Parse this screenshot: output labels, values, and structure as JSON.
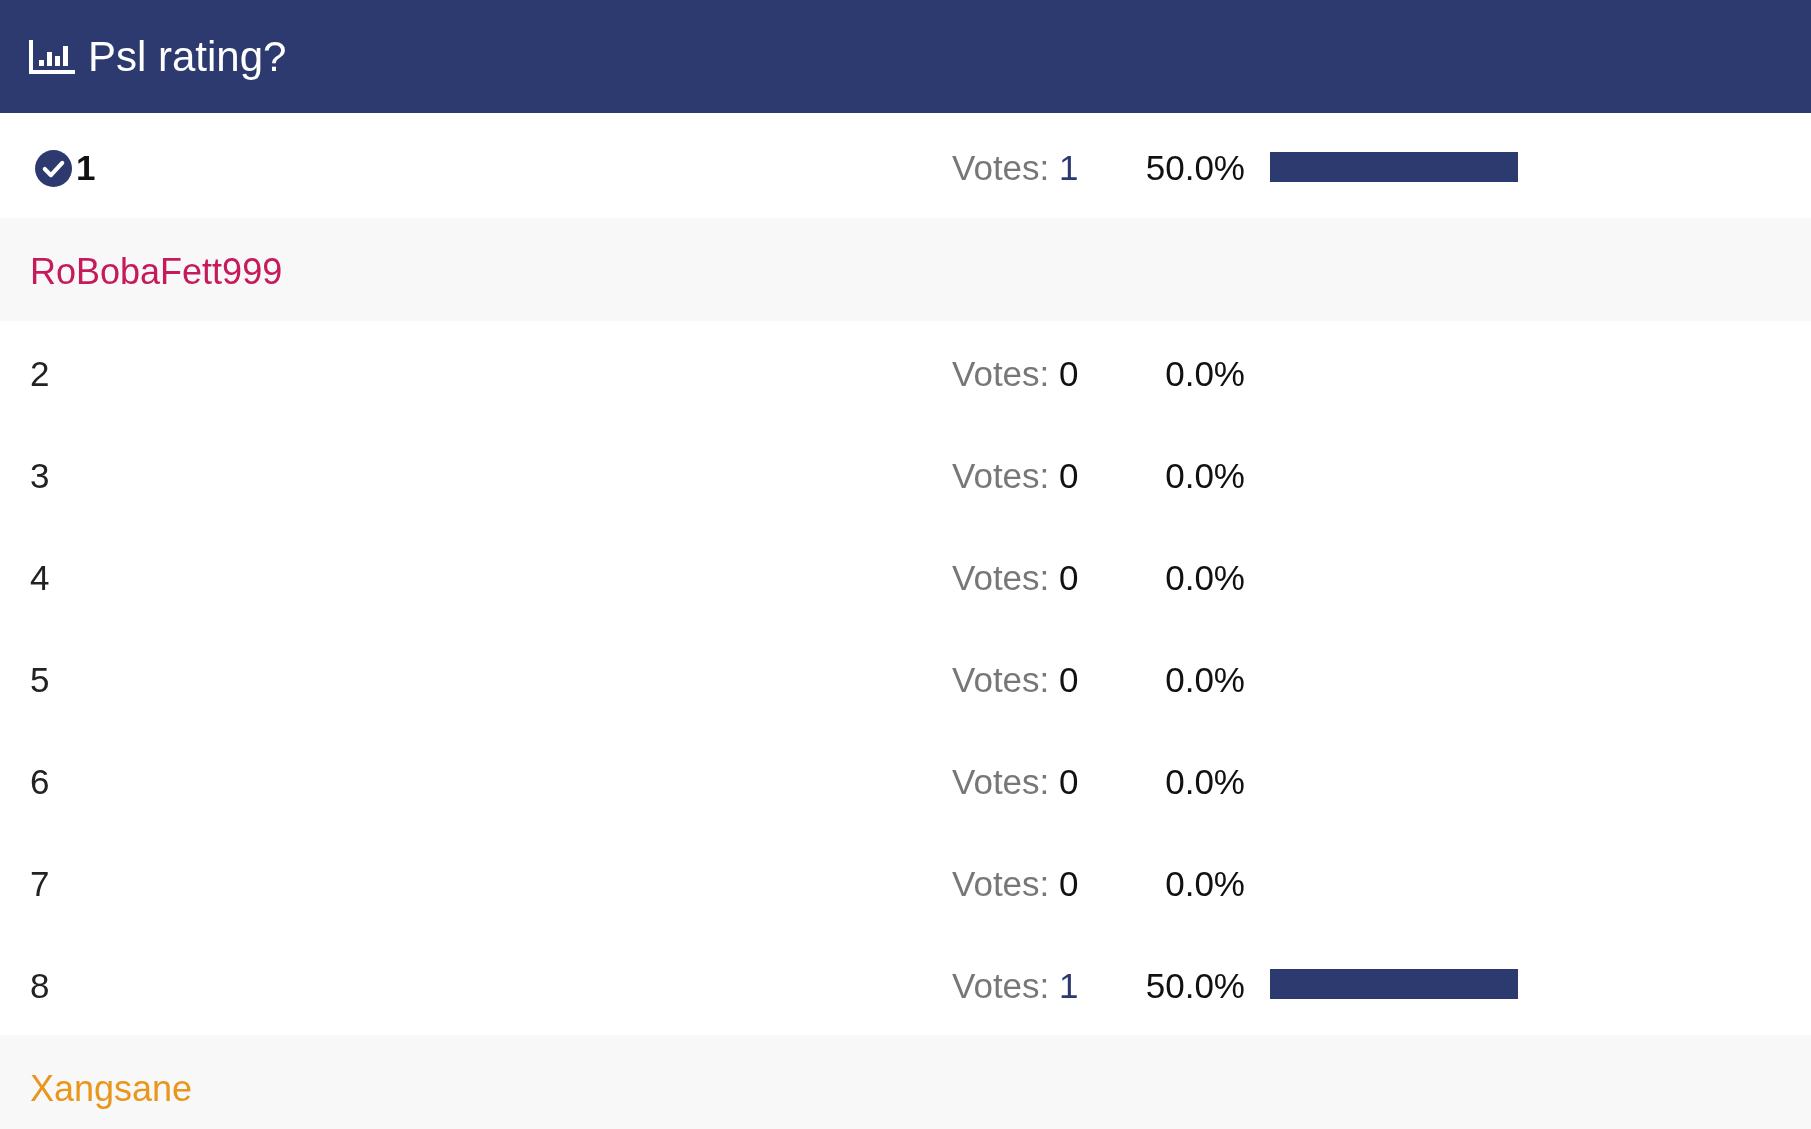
{
  "poll": {
    "title": "Psl rating?"
  },
  "options": [
    {
      "label": "1",
      "voted": true,
      "votes_label": "Votes:",
      "votes": "1",
      "percent": "50.0%",
      "level": 0.5,
      "voters": [
        {
          "name": "RoBobaFett999",
          "color": "#c61a5c"
        }
      ]
    },
    {
      "label": "2",
      "voted": false,
      "votes_label": "Votes:",
      "votes": "0",
      "percent": "0.0%"
    },
    {
      "label": "3",
      "voted": false,
      "votes_label": "Votes:",
      "votes": "0",
      "percent": "0.0%"
    },
    {
      "label": "4",
      "voted": false,
      "votes_label": "Votes:",
      "votes": "0",
      "percent": "0.0%"
    },
    {
      "label": "5",
      "voted": false,
      "votes_label": "Votes:",
      "votes": "0",
      "percent": "0.0%"
    },
    {
      "label": "6",
      "voted": false,
      "votes_label": "Votes:",
      "votes": "0",
      "percent": "0.0%"
    },
    {
      "label": "7",
      "voted": false,
      "votes_label": "Votes:",
      "votes": "0",
      "percent": "0.0%"
    },
    {
      "label": "8",
      "voted": false,
      "votes_label": "Votes:",
      "votes": "1",
      "percent": "50.0%",
      "level": 0.5,
      "voters": [
        {
          "name": "Xangsane",
          "color": "#e8961c"
        }
      ]
    }
  ]
}
